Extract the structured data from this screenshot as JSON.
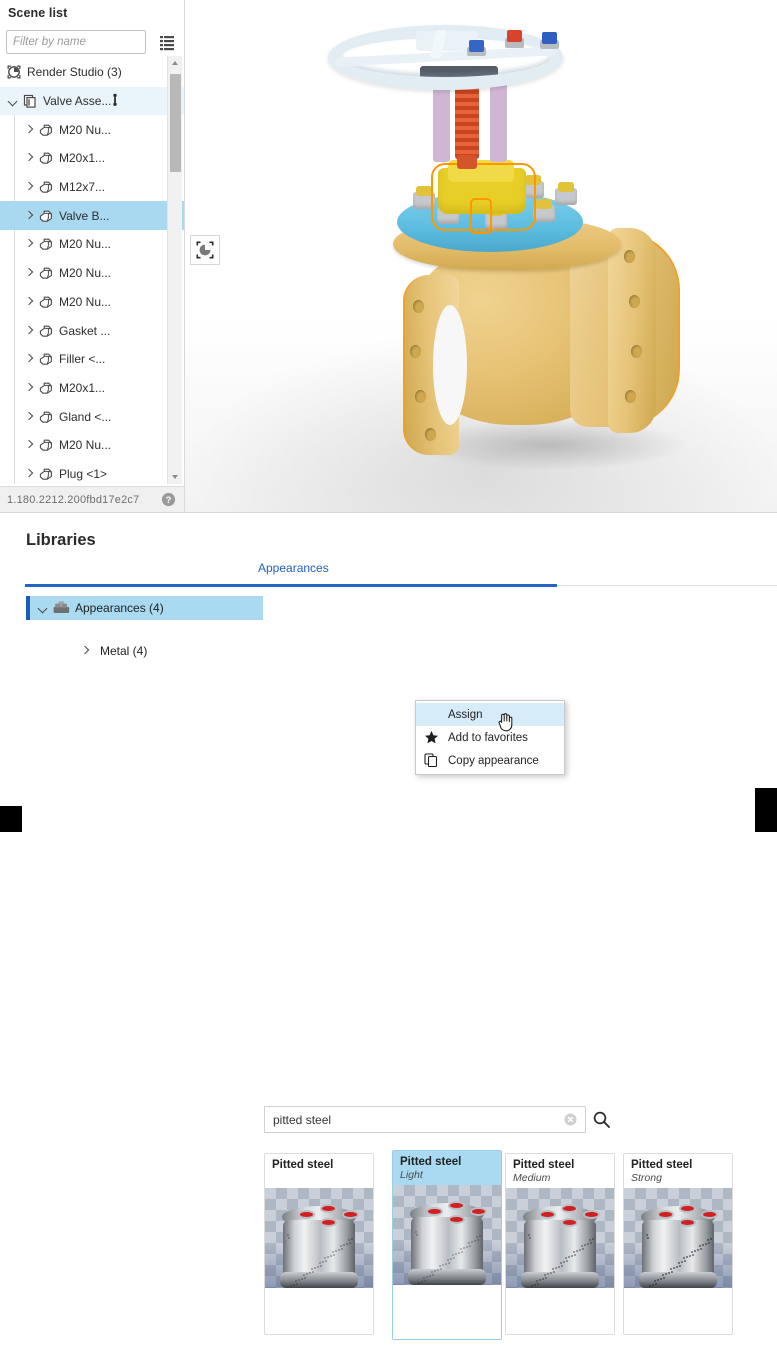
{
  "scene_panel": {
    "title": "Scene list",
    "filter_placeholder": "Filter by name",
    "filter_value": "",
    "list_options_icon": "list-options-icon",
    "root": {
      "label": "Render Studio (3)",
      "icon": "render-studio-icon"
    },
    "assembly": {
      "label": "Valve Asse...",
      "icon": "assembly-icon",
      "menu_icon": "more-vertical-icon"
    },
    "items": [
      {
        "label": "M20 Nu...",
        "icon": "part-icon"
      },
      {
        "label": "M20x1...",
        "icon": "part-icon"
      },
      {
        "label": "M12x7...",
        "icon": "part-icon"
      },
      {
        "label": "Valve B...",
        "icon": "part-icon",
        "selected": true
      },
      {
        "label": "M20 Nu...",
        "icon": "part-icon"
      },
      {
        "label": "M20 Nu...",
        "icon": "part-icon"
      },
      {
        "label": "M20 Nu...",
        "icon": "part-icon"
      },
      {
        "label": "Gasket ...",
        "icon": "part-icon"
      },
      {
        "label": "Filler <...",
        "icon": "part-icon"
      },
      {
        "label": "M20x1...",
        "icon": "part-icon"
      },
      {
        "label": "Gland <...",
        "icon": "part-icon"
      },
      {
        "label": "M20 Nu...",
        "icon": "part-icon"
      },
      {
        "label": "Plug <1>",
        "icon": "part-icon"
      }
    ],
    "status": {
      "version": "1.180.2212.200fbd17e2c7",
      "help_icon": "help-circle-icon"
    }
  },
  "viewport": {
    "fit_button_icon": "zoom-to-selection-icon",
    "model_name": "valve-assembly-3d-model",
    "selection_color": "#ff9800"
  },
  "libraries": {
    "title": "Libraries",
    "tabs": [
      {
        "label": "Appearances",
        "active": true
      }
    ],
    "tree": [
      {
        "label": "Appearances (4)",
        "icon": "appearances-folder-icon",
        "selected": true,
        "expanded": true
      },
      {
        "label": "Metal (4)",
        "icon": "",
        "selected": false,
        "expanded": false
      }
    ],
    "search": {
      "value": "pitted steel",
      "placeholder": "Search",
      "clear_icon": "clear-circle-icon",
      "search_icon": "search-icon"
    },
    "cards": [
      {
        "title": "Pitted steel",
        "subtitle": "",
        "selected": false
      },
      {
        "title": "Pitted steel",
        "subtitle": "Light",
        "selected": true
      },
      {
        "title": "Pitted steel",
        "subtitle": "Medium",
        "selected": false
      },
      {
        "title": "Pitted steel",
        "subtitle": "Strong",
        "selected": false
      }
    ],
    "context_menu": [
      {
        "label": "Assign",
        "icon": "",
        "active": true
      },
      {
        "label": "Add to favorites",
        "icon": "star-icon",
        "active": false
      },
      {
        "label": "Copy appearance",
        "icon": "copy-icon",
        "active": false
      }
    ]
  },
  "colors": {
    "accent_blue": "#2563c9",
    "selection_row": "#a8d9f0",
    "menu_highlight": "#d7ecf9",
    "panel_border": "#d9d9d9"
  }
}
